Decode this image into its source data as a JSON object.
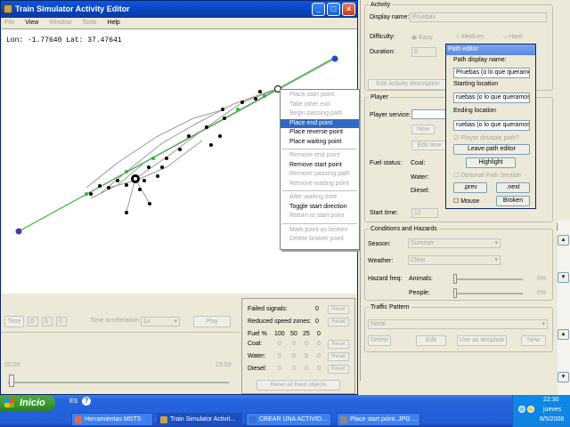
{
  "window": {
    "title": "Train Simulator Activity Editor",
    "menu": [
      {
        "label": "File",
        "enabled": false
      },
      {
        "label": "View",
        "enabled": true
      },
      {
        "label": "Window",
        "enabled": false
      },
      {
        "label": "Tools",
        "enabled": false
      },
      {
        "label": "Help",
        "enabled": true
      }
    ],
    "minimize": "_",
    "maximize": "□",
    "close": "×"
  },
  "map": {
    "coords": "Lon: -1.77640 Lat: 37.47641"
  },
  "context_menu": {
    "group1": [
      {
        "label": "Place start point",
        "enabled": false
      },
      {
        "label": "Take other exit",
        "enabled": false
      },
      {
        "label": "Begin passing path",
        "enabled": false
      },
      {
        "label": "Place end point",
        "enabled": true,
        "selected": true
      },
      {
        "label": "Place reverse point",
        "enabled": true
      },
      {
        "label": "Place waiting point",
        "enabled": true
      }
    ],
    "group2": [
      {
        "label": "Remove end point",
        "enabled": false
      },
      {
        "label": "Remove start point",
        "enabled": true
      },
      {
        "label": "Remove passing path",
        "enabled": false
      },
      {
        "label": "Remove waiting point",
        "enabled": false
      }
    ],
    "group3": [
      {
        "label": "Alter waiting time",
        "enabled": false
      },
      {
        "label": "Toggle start direction",
        "enabled": true
      },
      {
        "label": "Return to start point",
        "enabled": false
      }
    ],
    "group4": [
      {
        "label": "Mark point as broken",
        "enabled": false
      },
      {
        "label": "Delete broken point",
        "enabled": false
      }
    ]
  },
  "time_controls": {
    "time_button": "Time",
    "time_fields": [
      "0",
      "0",
      "0"
    ],
    "accel_label": "Time acceleration",
    "accel_value": "1x",
    "play_button": "Play",
    "slider_start": "00:00",
    "slider_end": "23:59"
  },
  "status_panel": {
    "failed_signals_label": "Failed signals:",
    "failed_signals_value": "0",
    "reduced_speed_label": "Reduced speed zones:",
    "reduced_speed_value": "0",
    "reset_label": "Reset",
    "fuel_header": [
      "Fuel %",
      "100",
      "50",
      "25",
      "0"
    ],
    "coal_label": "Coal:",
    "water_label": "Water:",
    "diesel_label": "Diesel:",
    "zeros": [
      "0",
      "0",
      "0",
      "0"
    ],
    "reset_all_label": "Reset all fixed objects"
  },
  "activity_panel": {
    "activity_legend": "Activity",
    "display_name_label": "Display name:",
    "display_name_value": "Pruebas",
    "difficulty_label": "Difficulty:",
    "difficulty_options": [
      "Easy",
      "Medium",
      "Hard"
    ],
    "duration_label": "Duration:",
    "duration_value": "0",
    "edit_description": "Edit Activity description",
    "player_legend": "Player",
    "player_service_label": "Player service:",
    "new_label": "New",
    "edit_time_label": "Edit time",
    "fuel_status_label": "Fuel status:",
    "coal_label": "Coal:",
    "water_label": "Water:",
    "diesel_label": "Diesel:",
    "start_time_label": "Start time:",
    "start_time_value": "12",
    "conditions_legend": "Conditions and Hazards",
    "season_label": "Season:",
    "season_value": "Summer",
    "weather_label": "Weather:",
    "weather_value": "Clear",
    "hazard_label": "Hazard freq:",
    "animals_label": "Animals:",
    "people_label": "People:",
    "hazard_percent": "0%",
    "traffic_legend": "Traffic Pattern",
    "traffic_value": "None",
    "traffic_buttons": [
      "Delete",
      "Edit",
      "Use as template",
      "New"
    ]
  },
  "path_editor": {
    "title": "Path editor",
    "display_name_label": "Path display name:",
    "display_name_value": "Pruebas (o lo que queramos",
    "start_label": "Starting location",
    "start_value": "ruebas (o lo que queramos).",
    "end_label": "Ending location",
    "end_value": "ruebas (o lo que queramos).",
    "drivable_label": "Player drivable path?",
    "leave_button": "Leave path editor",
    "highlight_button": "Highlight",
    "optional_label": "Optional Path Section",
    "prev_button": ".prev",
    "next_button": ".next",
    "mouse_label": "Mouse",
    "broken_button": "Broken"
  },
  "taskbar": {
    "start_label": "Inicio",
    "lang": "ES",
    "tasks": [
      {
        "label": "Herramientas MSTS",
        "color": "#e8694a"
      },
      {
        "label": "Train Simulator Activit...",
        "color": "#c8a050"
      },
      {
        "label": "CREAR UNA ACTIVID...",
        "color": "#3b6fd6"
      },
      {
        "label": "Place start point..JPG ...",
        "color": "#8a8a8a"
      }
    ],
    "clock": "22:30",
    "day": "jueves",
    "date": "8/5/2008"
  }
}
